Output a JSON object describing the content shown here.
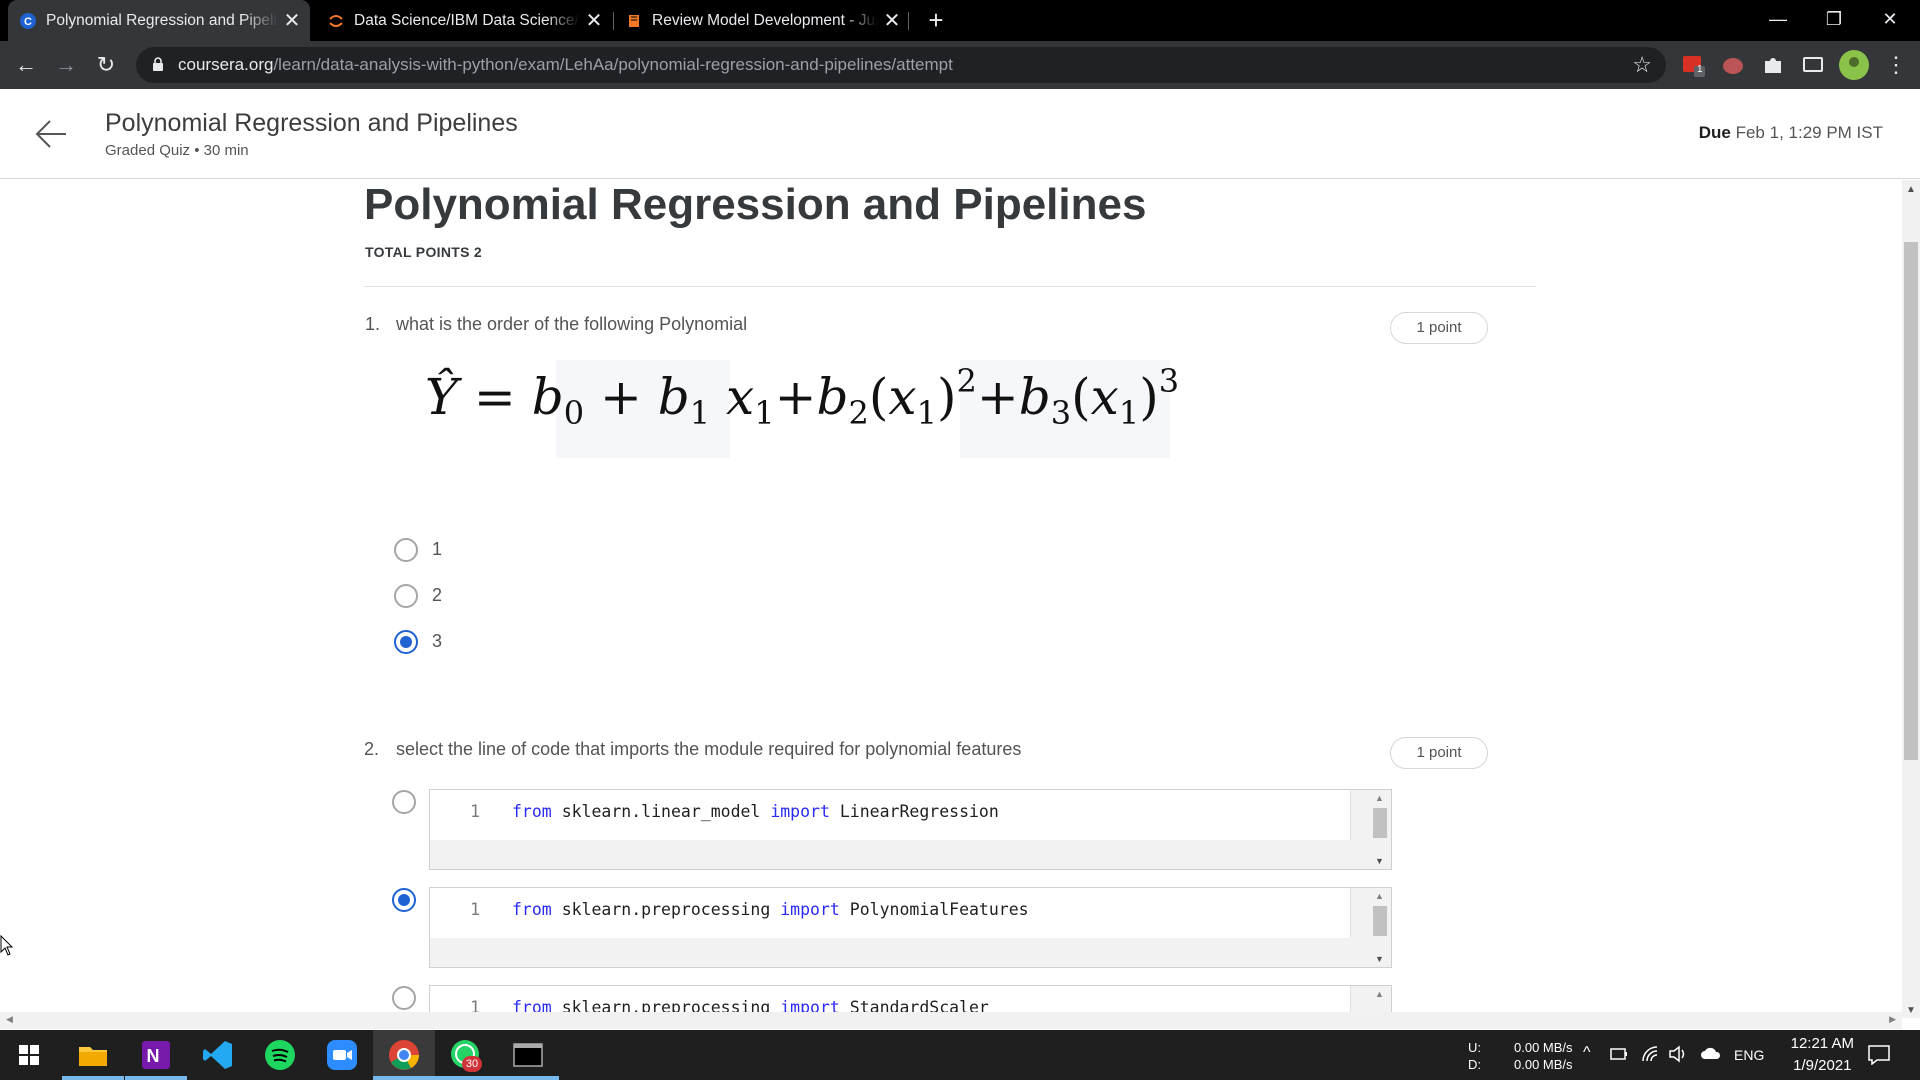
{
  "browser": {
    "tabs": [
      {
        "title": "Polynomial Regression and Pipeli",
        "icon": "coursera-icon"
      },
      {
        "title": "Data Science/IBM Data Science/6",
        "icon": "jupyter-icon"
      },
      {
        "title": "Review Model Development - Jup",
        "icon": "book-icon"
      }
    ],
    "url_host": "coursera.org",
    "url_path": "/learn/data-analysis-with-python/exam/LehAa/polynomial-regression-and-pipelines/attempt",
    "extension_badge": "1"
  },
  "header": {
    "title": "Polynomial Regression and Pipelines",
    "subtitle": "Graded Quiz • 30 min",
    "due_label": "Due",
    "due_value": "Feb 1, 1:29 PM IST"
  },
  "quiz": {
    "heading": "Polynomial Regression and Pipelines",
    "total_points": "TOTAL POINTS 2",
    "q1": {
      "number": "1.",
      "text": "what is the order of the following Polynomial",
      "points": "1 point",
      "options": [
        "1",
        "2",
        "3"
      ],
      "selected": "3"
    },
    "q2": {
      "number": "2.",
      "text": "select the line of code that imports the module  required for polynomial features",
      "points": "1 point",
      "options": [
        {
          "line_no": "1",
          "kw1": "from",
          "module": "sklearn.linear_model",
          "kw2": "import",
          "name": "LinearRegression"
        },
        {
          "line_no": "1",
          "kw1": "from",
          "module": "sklearn.preprocessing",
          "kw2": "import",
          "name": "PolynomialFeatures"
        },
        {
          "line_no": "1",
          "kw1": "from",
          "module": "sklearn.preprocessing",
          "kw2": "import",
          "name": "StandardScaler"
        }
      ],
      "selected_index": 1
    }
  },
  "taskbar": {
    "net_up_label": "U:",
    "net_down_label": "D:",
    "net_up": "0.00 MB/s",
    "net_down": "0.00 MB/s",
    "lang": "ENG",
    "time": "12:21 AM",
    "date": "1/9/2021",
    "whatsapp_badge": "30"
  },
  "colors": {
    "accent": "#1f63d2",
    "keyword": "#2a2af5"
  }
}
